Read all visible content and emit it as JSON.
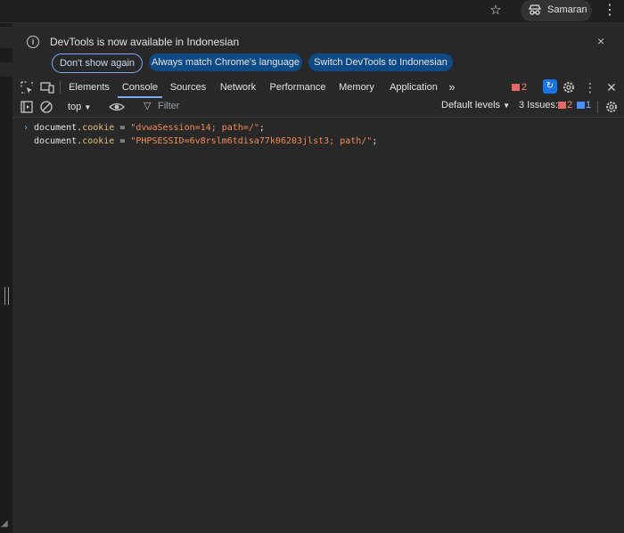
{
  "browser": {
    "profile_name": "Samaran",
    "icons": {
      "bookmark": "star-icon",
      "profile": "incognito-icon",
      "menu": "more-vert-icon"
    }
  },
  "notification": {
    "message": "DevTools is now available in Indonesian",
    "buttons": {
      "dont_show": "Don't show again",
      "always_match": "Always match Chrome's language",
      "switch_lang": "Switch DevTools to Indonesian"
    },
    "close_glyph": "×"
  },
  "tabs": {
    "items": [
      "Elements",
      "Console",
      "Sources",
      "Network",
      "Performance",
      "Memory",
      "Application"
    ],
    "active": "Console",
    "more_glyph": "»",
    "error_count": "2"
  },
  "console_toolbar": {
    "context": "top",
    "filter_placeholder": "Filter",
    "levels": "Default levels",
    "issues_label": "3 Issues:",
    "issues_errors": "2",
    "issues_info": "1"
  },
  "console": {
    "lines": [
      {
        "obj": "document.",
        "prop": "cookie",
        "op": " = ",
        "str": "\"dvwaSession=14; path=/\"",
        "end": ";"
      },
      {
        "obj": "document.",
        "prop": "cookie",
        "op": " = ",
        "str": "\"PHPSESSID=6v8rslm6tdisa77k06203jlst3; path/\"",
        "end": ";"
      }
    ]
  },
  "colors": {
    "background": "#282828",
    "accent": "#7cacf8",
    "error": "#e46962",
    "string": "#f28b54",
    "property": "#e5c07b"
  }
}
